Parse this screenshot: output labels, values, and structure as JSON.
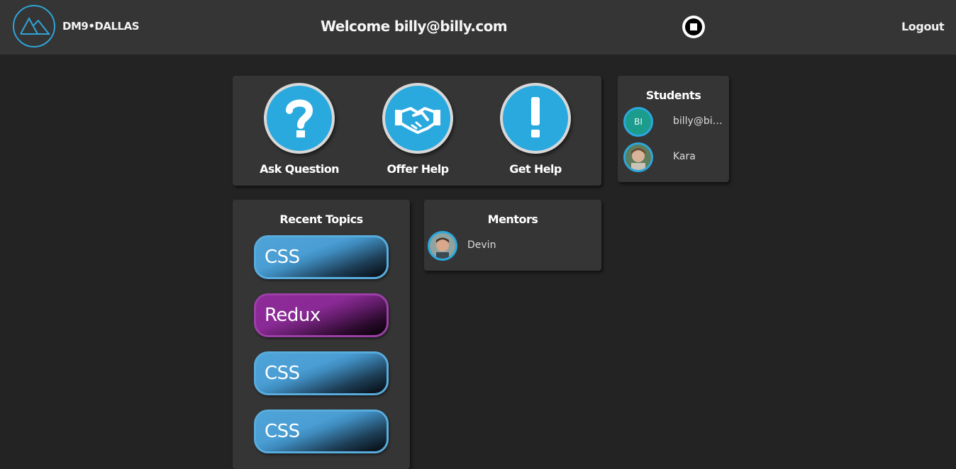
{
  "header": {
    "brand": "DM9•DALLAS",
    "welcome": "Welcome billy@billy.com",
    "logout": "Logout"
  },
  "actions": [
    {
      "label": "Ask Question",
      "icon": "question-mark-icon"
    },
    {
      "label": "Offer Help",
      "icon": "handshake-icon"
    },
    {
      "label": "Get Help",
      "icon": "exclamation-icon"
    }
  ],
  "students": {
    "title": "Students",
    "items": [
      {
        "initials": "BI",
        "name": "billy@billy.com"
      },
      {
        "initials": "",
        "name": "Kara"
      }
    ]
  },
  "recent_topics": {
    "title": "Recent Topics",
    "items": [
      {
        "label": "CSS",
        "color": "#4ea3d8"
      },
      {
        "label": "Redux",
        "color": "#8e2b98"
      },
      {
        "label": "CSS",
        "color": "#4ea3d8"
      },
      {
        "label": "CSS",
        "color": "#4ea3d8"
      }
    ]
  },
  "mentors": {
    "title": "Mentors",
    "items": [
      {
        "name": "Devin"
      }
    ]
  },
  "colors": {
    "accent": "#2aa9de",
    "background": "#232323",
    "card": "#353535",
    "header": "#353535"
  }
}
